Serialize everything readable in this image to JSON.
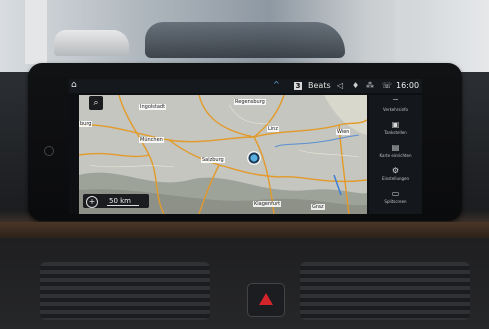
{
  "status_bar": {
    "home_icon": "home-icon",
    "expand_icon": "chevron-up-icon",
    "preset_number": "3",
    "audio_source": "Beats",
    "icons": [
      "speaker-icon",
      "microphone-icon",
      "network-icon",
      "phone-icon"
    ],
    "time": "16:00"
  },
  "map": {
    "labels": [
      {
        "id": "ingolstadt",
        "text": "Ingolstadt"
      },
      {
        "id": "regensburg",
        "text": "Regensburg"
      },
      {
        "id": "muenchen",
        "text": "München"
      },
      {
        "id": "salzburg",
        "text": "Salzburg"
      },
      {
        "id": "linz",
        "text": "Linz"
      },
      {
        "id": "wien",
        "text": "Wien"
      },
      {
        "id": "burg",
        "text": "burg"
      },
      {
        "id": "graz",
        "text": "Graz"
      },
      {
        "id": "klagenfurt",
        "text": "Klagenfurt"
      }
    ],
    "scale_text": "50 km",
    "search_icon": "magnifier-icon",
    "zoom_icon": "zoom-in-icon"
  },
  "side_menu": [
    {
      "icon": "traffic-icon",
      "label": "Verkehrsinfo"
    },
    {
      "icon": "fuel-icon",
      "label": "Tankstellen"
    },
    {
      "icon": "map-settings-icon",
      "label": "Karte einrichten"
    },
    {
      "icon": "gear-icon",
      "label": "Einstellungen"
    },
    {
      "icon": "split-screen-icon",
      "label": "Splitscreen"
    }
  ],
  "colors": {
    "accent": "#5aaee0",
    "hazard": "#d2242a"
  }
}
